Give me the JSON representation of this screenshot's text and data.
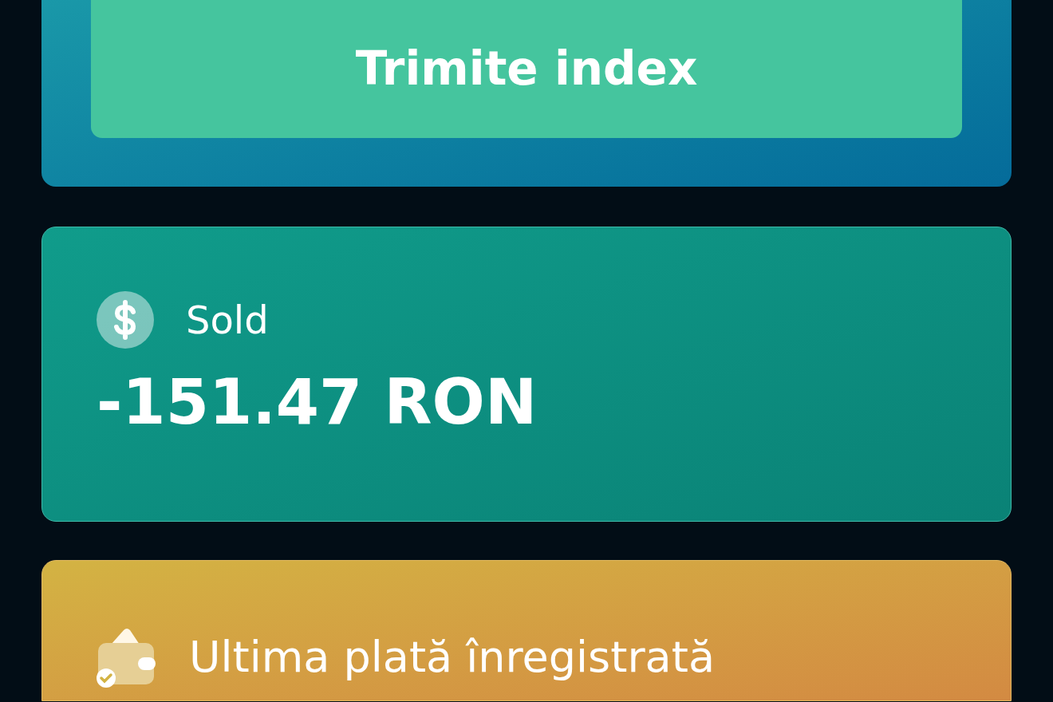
{
  "submit_button": {
    "label": "Trimite index"
  },
  "cards": [
    {
      "kind": "balance",
      "label": "Sold",
      "value": "-151.47 RON"
    },
    {
      "kind": "payment",
      "label": "Ultima plată înregistrată"
    }
  ]
}
